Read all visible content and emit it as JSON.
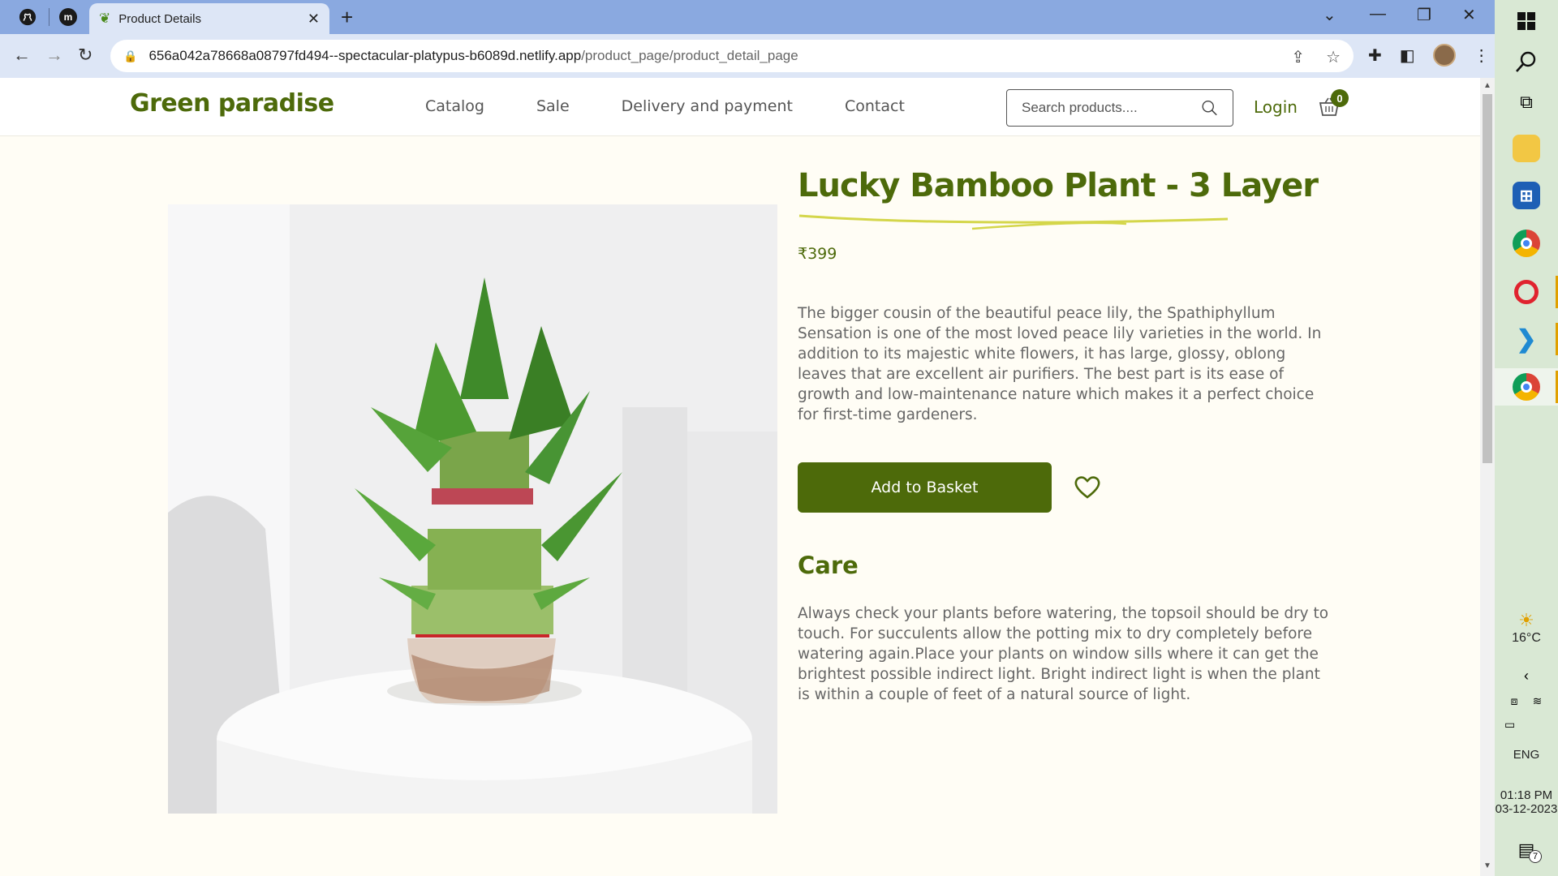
{
  "browser": {
    "tab_title": "Product Details",
    "url_host": "656a042a78668a08797fd494--spectacular-platypus-b6089d.netlify.app",
    "url_path": "/product_page/product_detail_page"
  },
  "site": {
    "logo": "Green paradise",
    "nav": [
      "Catalog",
      "Sale",
      "Delivery and payment",
      "Contact"
    ],
    "search_placeholder": "Search products....",
    "login": "Login",
    "cart_count": "0"
  },
  "product": {
    "title": "Lucky Bamboo Plant - 3 Layer",
    "price": "₹399",
    "description": "The bigger cousin of the beautiful peace lily, the Spathiphyllum Sensation is one of the most loved peace lily varieties in the world. In addition to its majestic white flowers, it has large, glossy, oblong leaves that are excellent air purifiers. The best part is its ease of growth and low-maintenance nature which makes it a perfect choice for first-time gardeners.",
    "add_button": "Add to Basket",
    "care_title": "Care",
    "care_text": "Always check your plants before watering, the topsoil should be dry to touch. For succulents allow the potting mix to dry completely before watering again.Place your plants on window sills where it can get the brightest possible indirect light. Bright indirect light is when the plant is within a couple of feet of a natural source of light."
  },
  "taskbar": {
    "weather": "16°C",
    "language": "ENG",
    "time": "01:18 PM",
    "date": "03-12-2023",
    "notifications": "7"
  },
  "colors": {
    "brand": "#4d6a0a",
    "tabbar": "#8aa9e0",
    "taskbar": "#d9e8d4"
  }
}
